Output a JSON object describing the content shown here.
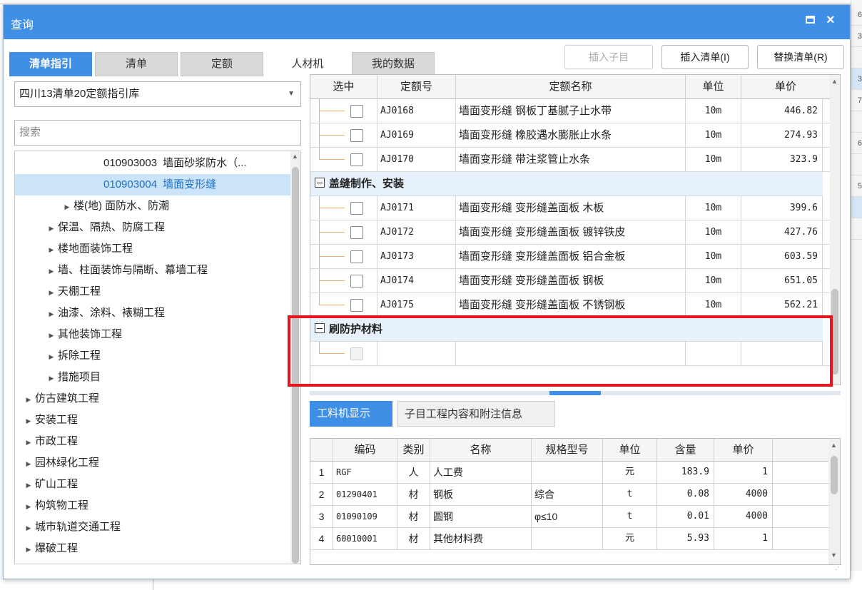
{
  "background": {
    "right_strip": [
      "6",
      "3",
      "",
      "3",
      "7",
      "",
      "6",
      "",
      "5",
      "",
      ""
    ]
  },
  "dialog": {
    "title": "查询",
    "max_icon": "maximize-icon",
    "close_label": "×"
  },
  "tabs": [
    {
      "label": "清单指引",
      "active": true
    },
    {
      "label": "清单",
      "active": false
    },
    {
      "label": "定额",
      "active": false
    },
    {
      "label": "人材机",
      "active": false
    },
    {
      "label": "我的数据",
      "active": false
    }
  ],
  "toolbar": {
    "insert_child": "插入子目",
    "insert_list": "插入清单(I)",
    "replace_list": "替换清单(R)"
  },
  "left": {
    "library_value": "四川13清单20定额指引库",
    "search_placeholder": "搜索",
    "tree": [
      {
        "indent": 4,
        "expander": "",
        "code": "010903003",
        "label": "墙面砂浆防水（...",
        "selected": false
      },
      {
        "indent": 4,
        "expander": "",
        "code": "010903004",
        "label": "墙面变形缝",
        "selected": true
      },
      {
        "indent": 3,
        "expander": "▶",
        "code": "",
        "label": "楼(地) 面防水、防潮",
        "selected": false
      },
      {
        "indent": 2,
        "expander": "▶",
        "code": "",
        "label": "保温、隔热、防腐工程",
        "selected": false
      },
      {
        "indent": 2,
        "expander": "▶",
        "code": "",
        "label": "楼地面装饰工程",
        "selected": false
      },
      {
        "indent": 2,
        "expander": "▶",
        "code": "",
        "label": "墙、柱面装饰与隔断、幕墙工程",
        "selected": false
      },
      {
        "indent": 2,
        "expander": "▶",
        "code": "",
        "label": "天棚工程",
        "selected": false
      },
      {
        "indent": 2,
        "expander": "▶",
        "code": "",
        "label": "油漆、涂料、裱糊工程",
        "selected": false
      },
      {
        "indent": 2,
        "expander": "▶",
        "code": "",
        "label": "其他装饰工程",
        "selected": false
      },
      {
        "indent": 2,
        "expander": "▶",
        "code": "",
        "label": "拆除工程",
        "selected": false
      },
      {
        "indent": 2,
        "expander": "▶",
        "code": "",
        "label": "措施项目",
        "selected": false
      },
      {
        "indent": 1,
        "expander": "▶",
        "code": "",
        "label": "仿古建筑工程",
        "selected": false
      },
      {
        "indent": 1,
        "expander": "▶",
        "code": "",
        "label": "安装工程",
        "selected": false
      },
      {
        "indent": 1,
        "expander": "▶",
        "code": "",
        "label": "市政工程",
        "selected": false
      },
      {
        "indent": 1,
        "expander": "▶",
        "code": "",
        "label": "园林绿化工程",
        "selected": false
      },
      {
        "indent": 1,
        "expander": "▶",
        "code": "",
        "label": "矿山工程",
        "selected": false
      },
      {
        "indent": 1,
        "expander": "▶",
        "code": "",
        "label": "构筑物工程",
        "selected": false
      },
      {
        "indent": 1,
        "expander": "▶",
        "code": "",
        "label": "城市轨道交通工程",
        "selected": false
      },
      {
        "indent": 1,
        "expander": "▶",
        "code": "",
        "label": "爆破工程",
        "selected": false
      }
    ]
  },
  "quota_grid": {
    "headers": [
      "选中",
      "定额号",
      "定额名称",
      "单位",
      "单价"
    ],
    "rows": [
      {
        "kind": "item",
        "code": "AJ0168",
        "name": "墙面变形缝 钢板丁基腻子止水带",
        "unit": "10m",
        "price": "446.82"
      },
      {
        "kind": "item",
        "code": "AJ0169",
        "name": "墙面变形缝 橡胶遇水膨胀止水条",
        "unit": "10m",
        "price": "274.93"
      },
      {
        "kind": "item",
        "code": "AJ0170",
        "name": "墙面变形缝 带注浆管止水条",
        "unit": "10m",
        "price": "323.9"
      },
      {
        "kind": "group",
        "name": "盖缝制作、安装"
      },
      {
        "kind": "item",
        "code": "AJ0171",
        "name": "墙面变形缝 变形缝盖面板 木板",
        "unit": "10m",
        "price": "399.6"
      },
      {
        "kind": "item",
        "code": "AJ0172",
        "name": "墙面变形缝 变形缝盖面板 镀锌铁皮",
        "unit": "10m",
        "price": "427.76"
      },
      {
        "kind": "item",
        "code": "AJ0173",
        "name": "墙面变形缝 变形缝盖面板 铝合金板",
        "unit": "10m",
        "price": "603.59"
      },
      {
        "kind": "item",
        "code": "AJ0174",
        "name": "墙面变形缝 变形缝盖面板 钢板",
        "unit": "10m",
        "price": "651.05"
      },
      {
        "kind": "item",
        "code": "AJ0175",
        "name": "墙面变形缝 变形缝盖面板 不锈钢板",
        "unit": "10m",
        "price": "562.21"
      },
      {
        "kind": "group",
        "name": "刷防护材料"
      },
      {
        "kind": "empty",
        "code": "",
        "name": "",
        "unit": "",
        "price": ""
      }
    ]
  },
  "bottom_tabs": [
    {
      "label": "工料机显示",
      "active": true
    },
    {
      "label": "子目工程内容和附注信息",
      "active": false
    }
  ],
  "material_grid": {
    "headers": [
      "",
      "编码",
      "类别",
      "名称",
      "规格型号",
      "单位",
      "含量",
      "单价"
    ],
    "rows": [
      {
        "idx": "1",
        "code": "RGF",
        "type": "人",
        "name": "人工费",
        "spec": "",
        "unit": "元",
        "qty": "183.9",
        "price": "1"
      },
      {
        "idx": "2",
        "code": "01290401",
        "type": "材",
        "name": "钢板",
        "spec": "综合",
        "unit": "t",
        "qty": "0.08",
        "price": "4000"
      },
      {
        "idx": "3",
        "code": "01090109",
        "type": "材",
        "name": "圆钢",
        "spec": "φ≤10",
        "unit": "t",
        "qty": "0.01",
        "price": "4000"
      },
      {
        "idx": "4",
        "code": "60010001",
        "type": "材",
        "name": "其他材料费",
        "spec": "",
        "unit": "元",
        "qty": "5.93",
        "price": "1"
      }
    ]
  }
}
